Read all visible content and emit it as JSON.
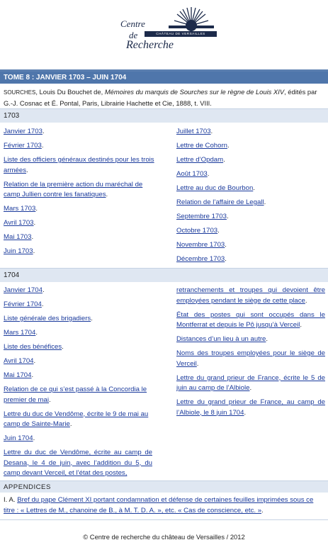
{
  "logo": {
    "line1": "Centre",
    "line2": "de",
    "line3": "Recherche",
    "band": "CHÂTEAU DE VERSAILLES"
  },
  "header": {
    "tome_title": "TOME 8 : JANVIER 1703 – JUIN 1704"
  },
  "source": {
    "author_sc": "Sourches",
    "author_rest": ", Louis Du Bouchet de, ",
    "book_title": "Mémoires du marquis de Sourches sur le règne de Louis XIV",
    "rest": ", édités par G.-J. Cosnac et É. Pontal, Paris, Librairie Hachette et Cie, 1888, t. VIII."
  },
  "sections": {
    "y1703": "1703",
    "y1704": "1704",
    "appendices": "APPENDICES"
  },
  "col_1703_left": [
    "Janvier 1703",
    "Février 1703",
    "Liste des officiers généraux destinés pour les trois armées",
    "Relation de la première action du maréchal de camp Jullien contre les fanatiques",
    "Mars 1703",
    "Avril 1703",
    "Mai 1703",
    "Juin 1703"
  ],
  "col_1703_right": [
    "Juillet 1703",
    "Lettre de Cohorn",
    "Lettre d’Opdam",
    "Août 1703",
    "Lettre au duc de Bourbon",
    "Relation de l’affaire de Legall",
    "Septembre 1703",
    "Octobre 1703",
    "Novembre 1703",
    "Décembre 1703"
  ],
  "col_1704_left": [
    "Janvier 1704",
    "Février 1704",
    "Liste générale des brigadiers",
    "Mars 1704",
    "Liste des bénéfices",
    "Avril 1704",
    "Mai 1704",
    "Relation de ce qui s’est passé à la Concordia le premier de mai",
    "Lettre du duc de Vendôme, écrite le 9 de mai au camp de Sainte-Marie",
    "Juin 1704",
    "Lettre du duc de Vendôme, écrite au camp de Desana, le 4 de juin, avec l’addition du 5, du camp devant Verceil, et l’état des postes,"
  ],
  "col_1704_right": [
    "retranchements et troupes qui devoient être employées pendant le siège de cette place",
    "État des postes qui sont occupés dans le Montferrat et depuis le Pô jusqu’à Verceil",
    "Distances d’un lieu à un autre",
    "Noms des troupes employées pour le siège de Verceil",
    "Lettre du grand prieur de France, écrite le 5 de juin au camp de l’Albiole",
    "Lettre du grand prieur de France, au camp de l’Albiole, le 8 juin 1704"
  ],
  "appendix": {
    "prefix": "I. A. ",
    "link": "Bref du pape Clément XI portant condamnation et défense de certaines feuilles imprimées sous ce titre : « Lettres de M., chanoine de B., à M. T. D. A. », etc. « Cas de conscience, etc. »",
    "suffix": "."
  },
  "footer": {
    "text": "© Centre de recherche du château de Versailles / 2012"
  }
}
